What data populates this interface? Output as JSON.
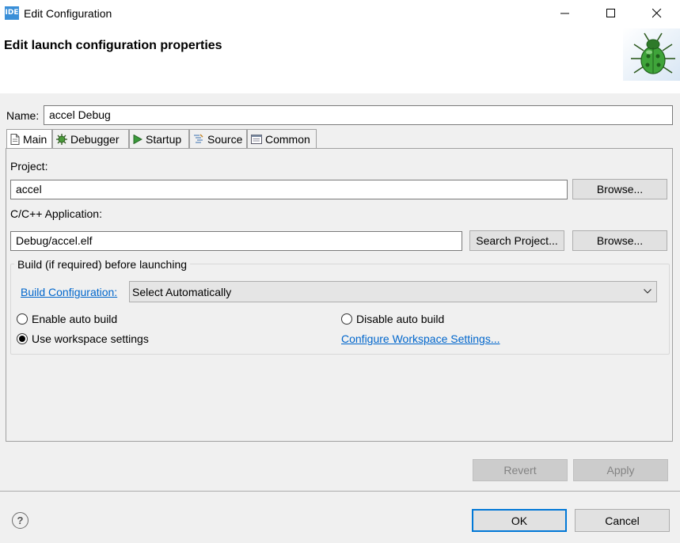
{
  "window": {
    "app_icon_text": "IDE",
    "title": "Edit Configuration",
    "minimize_icon": "minimize-icon",
    "maximize_icon": "maximize-icon",
    "close_icon": "close-icon"
  },
  "header": {
    "title": "Edit launch configuration properties",
    "banner_icon": "bug-icon"
  },
  "name_field": {
    "label": "Name:",
    "value": "accel Debug"
  },
  "tabs": [
    {
      "label": "Main",
      "icon": "document-icon",
      "active": true
    },
    {
      "label": "Debugger",
      "icon": "gear-bug-icon",
      "active": false
    },
    {
      "label": "Startup",
      "icon": "play-icon",
      "active": false
    },
    {
      "label": "Source",
      "icon": "source-icon",
      "active": false
    },
    {
      "label": "Common",
      "icon": "window-icon",
      "active": false
    }
  ],
  "main_tab": {
    "project_label": "Project:",
    "project_value": "accel",
    "project_browse": "Browse...",
    "application_label": "C/C++ Application:",
    "application_value": "Debug/accel.elf",
    "search_project": "Search Project...",
    "application_browse": "Browse...",
    "build_group": {
      "title": "Build (if required) before launching",
      "build_config_link": "Build Configuration:",
      "build_config_value": "Select Automatically",
      "enable_auto_build": "Enable auto build",
      "disable_auto_build": "Disable auto build",
      "use_workspace_settings": "Use workspace settings",
      "configure_workspace_link": "Configure Workspace Settings...",
      "selected": "use_workspace_settings"
    }
  },
  "actions": {
    "revert": "Revert",
    "apply": "Apply",
    "ok": "OK",
    "cancel": "Cancel",
    "help_icon": "help-icon"
  }
}
